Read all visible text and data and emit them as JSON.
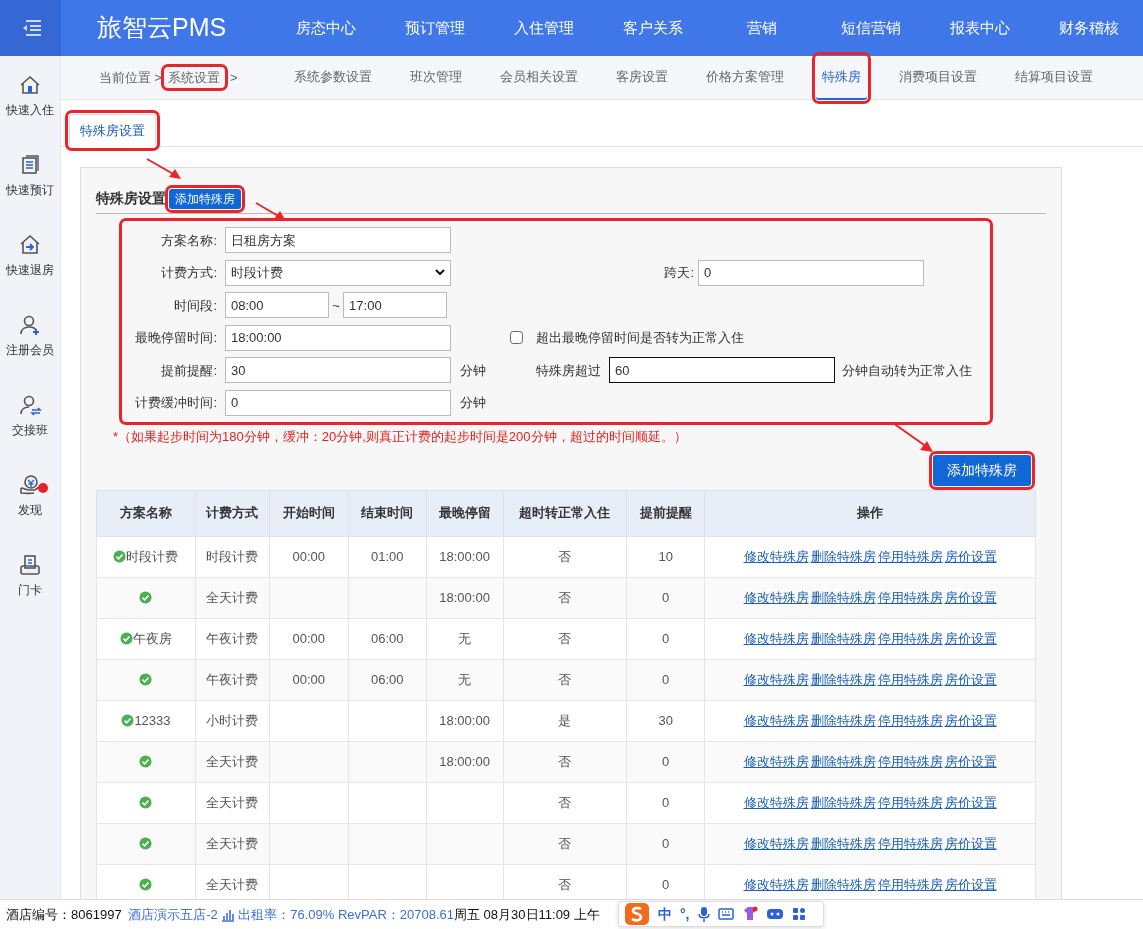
{
  "header": {
    "logo": "旅智云PMS",
    "menu": [
      "房态中心",
      "预订管理",
      "入住管理",
      "客户关系",
      "营销",
      "短信营销",
      "报表中心",
      "财务稽核"
    ]
  },
  "sidebar": [
    {
      "label": "快速入住",
      "kind": "home",
      "badge": false
    },
    {
      "label": "快速预订",
      "kind": "docs",
      "badge": false
    },
    {
      "label": "快速退房",
      "kind": "checkout",
      "badge": false
    },
    {
      "label": "注册会员",
      "kind": "useradd",
      "badge": false
    },
    {
      "label": "交接班",
      "kind": "userswap",
      "badge": false
    },
    {
      "label": "发现",
      "kind": "coinhand",
      "badge": true
    },
    {
      "label": "门卡",
      "kind": "card",
      "badge": false
    }
  ],
  "breadcrumb": {
    "label": "当前位置",
    "separator_1": ">",
    "current": "系统设置",
    "separator_2": ">",
    "highlighted": true
  },
  "subnav": [
    {
      "label": "系统参数设置",
      "selected": false,
      "highlighted": false
    },
    {
      "label": "班次管理",
      "selected": false,
      "highlighted": false
    },
    {
      "label": "会员相关设置",
      "selected": false,
      "highlighted": false
    },
    {
      "label": "客房设置",
      "selected": false,
      "highlighted": false
    },
    {
      "label": "价格方案管理",
      "selected": false,
      "highlighted": false
    },
    {
      "label": "特殊房",
      "selected": true,
      "highlighted": true
    },
    {
      "label": "消费项目设置",
      "selected": false,
      "highlighted": false
    },
    {
      "label": "结算项目设置",
      "selected": false,
      "highlighted": false
    }
  ],
  "tabs": [
    {
      "label": "特殊房设置",
      "selected": true,
      "highlighted": true
    }
  ],
  "panel": {
    "title": "特殊房设置",
    "add_button": {
      "label": "添加特殊房",
      "highlighted": true
    },
    "form": {
      "highlighted": true,
      "plan_name": {
        "label": "方案名称:",
        "value": "日租房方案"
      },
      "billing": {
        "label": "计费方式:",
        "value": "时段计费"
      },
      "cross_day": {
        "label": "跨天:",
        "value": "0"
      },
      "period": {
        "label": "时间段:",
        "start": "08:00",
        "tilde": "~",
        "end": "17:00"
      },
      "latest_stay": {
        "label": "最晚停留时间:",
        "value": "18:00:00"
      },
      "convert": {
        "label": "超出最晚停留时间是否转为正常入住",
        "checked": false
      },
      "remind": {
        "label": "提前提醒:",
        "value": "30",
        "unit": "分钟"
      },
      "overtime": {
        "label": "特殊房超过",
        "value": "60",
        "unit": "分钟自动转为正常入住"
      },
      "buffer": {
        "label": "计费缓冲时间:",
        "value": "0",
        "unit": "分钟"
      }
    },
    "note": "*（如果起步时间为180分钟，缓冲：20分钟,则真正计费的起步时间是200分钟，超过的时间顺延。）",
    "submit_button": {
      "label": "添加特殊房",
      "highlighted": true
    }
  },
  "table": {
    "columns": [
      "方案名称",
      "计费方式",
      "开始时间",
      "结束时间",
      "最晚停留",
      "超时转正常入住",
      "提前提醒",
      "操作"
    ],
    "rows": [
      {
        "name": "时段计费",
        "billing": "时段计费",
        "start": "00:00",
        "end": "01:00",
        "latest": "18:00:00",
        "convert": "否",
        "remind": "10",
        "actions": [
          "修改特殊房",
          "删除特殊房",
          "停用特殊房",
          "房价设置"
        ]
      },
      {
        "name": "",
        "billing": "全天计费",
        "start": "",
        "end": "",
        "latest": "18:00:00",
        "convert": "否",
        "remind": "0",
        "actions": [
          "修改特殊房",
          "删除特殊房",
          "停用特殊房",
          "房价设置"
        ]
      },
      {
        "name": "午夜房",
        "billing": "午夜计费",
        "start": "00:00",
        "end": "06:00",
        "latest": "无",
        "convert": "否",
        "remind": "0",
        "actions": [
          "修改特殊房",
          "删除特殊房",
          "停用特殊房",
          "房价设置"
        ]
      },
      {
        "name": "",
        "billing": "午夜计费",
        "start": "00:00",
        "end": "06:00",
        "latest": "无",
        "convert": "否",
        "remind": "0",
        "actions": [
          "修改特殊房",
          "删除特殊房",
          "停用特殊房",
          "房价设置"
        ]
      },
      {
        "name": "12333",
        "billing": "小时计费",
        "start": "",
        "end": "",
        "latest": "18:00:00",
        "convert": "是",
        "remind": "30",
        "actions": [
          "修改特殊房",
          "删除特殊房",
          "停用特殊房",
          "房价设置"
        ]
      },
      {
        "name": "",
        "billing": "全天计费",
        "start": "",
        "end": "",
        "latest": "18:00:00",
        "convert": "否",
        "remind": "0",
        "actions": [
          "修改特殊房",
          "删除特殊房",
          "停用特殊房",
          "房价设置"
        ]
      },
      {
        "name": "",
        "billing": "全天计费",
        "start": "",
        "end": "",
        "latest": "",
        "convert": "否",
        "remind": "0",
        "actions": [
          "修改特殊房",
          "删除特殊房",
          "停用特殊房",
          "房价设置"
        ]
      },
      {
        "name": "",
        "billing": "全天计费",
        "start": "",
        "end": "",
        "latest": "",
        "convert": "否",
        "remind": "0",
        "actions": [
          "修改特殊房",
          "删除特殊房",
          "停用特殊房",
          "房价设置"
        ]
      },
      {
        "name": "",
        "billing": "全天计费",
        "start": "",
        "end": "",
        "latest": "",
        "convert": "否",
        "remind": "0",
        "actions": [
          "修改特殊房",
          "删除特殊房",
          "停用特殊房",
          "房价设置"
        ]
      }
    ]
  },
  "status_bar": {
    "hotel_id": "酒店编号：8061997",
    "hotel_name": "酒店演示五店-2",
    "occupancy": "出租率：76.09% RevPAR：20708.61",
    "datetime": "周五 08月30日11:09 上午"
  },
  "ime": {
    "mode": "中",
    "punct": "°,"
  }
}
